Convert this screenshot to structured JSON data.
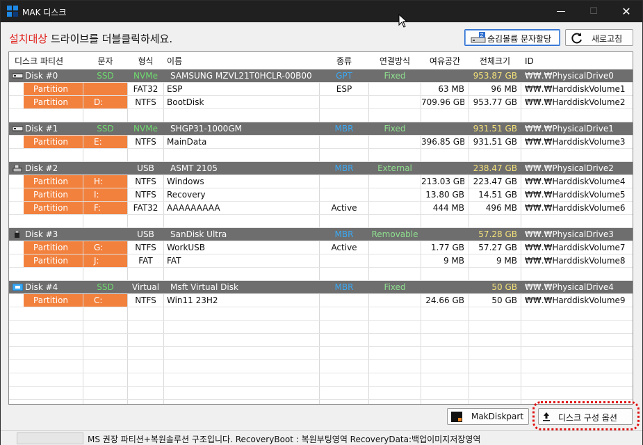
{
  "window": {
    "title": "MAK 디스크"
  },
  "instruction": {
    "highlight": "설치대상",
    "rest": " 드라이브를 더블클릭하세요."
  },
  "buttons": {
    "hide_volume": "숨김볼륨 문자할당",
    "refresh": "새로고침",
    "makdiskpart": "MakDiskpart",
    "disk_options": "디스크 구성 옵션"
  },
  "colors": {
    "disk_row_bg": "#6e6e6e",
    "partition_bg": "#f2813e",
    "ssd_green": "#6fdc6f",
    "style_blue": "#3aa9f5",
    "connect_green": "#8fe08f",
    "size_yellow": "#f5e27a",
    "accent_red": "#e0201c"
  },
  "columns": [
    "디스크 파티션",
    "문자",
    "형식",
    "이름",
    "종류",
    "연결방식",
    "여유공간",
    "전체크기",
    "ID"
  ],
  "rows": [
    {
      "kind": "disk",
      "icon": "hdd-icon",
      "label": "Disk #0",
      "letter": "SSD",
      "format": "NVMe",
      "name": "SAMSUNG MZVL21T0HCLR-00B00",
      "type": "GPT",
      "connection": "Fixed",
      "free": "",
      "total": "953.87 GB",
      "id": "₩₩.₩PhysicalDrive0"
    },
    {
      "kind": "part",
      "label": "Partition #1",
      "letter": "",
      "format": "FAT32",
      "name": "ESP",
      "type": "ESP",
      "connection": "",
      "free": "63 MB",
      "total": "96 MB",
      "id": "₩₩.₩HarddiskVolume1"
    },
    {
      "kind": "part",
      "label": "Partition #2",
      "letter": "D:",
      "format": "NTFS",
      "name": "BootDisk",
      "type": "",
      "connection": "",
      "free": "709.96 GB",
      "total": "953.77 GB",
      "id": "₩₩.₩HarddiskVolume2"
    },
    {
      "kind": "empty"
    },
    {
      "kind": "disk",
      "icon": "hdd-icon",
      "label": "Disk #1",
      "letter": "SSD",
      "format": "NVMe",
      "name": "SHGP31-1000GM",
      "type": "MBR",
      "connection": "Fixed",
      "free": "",
      "total": "931.51 GB",
      "id": "₩₩.₩PhysicalDrive1"
    },
    {
      "kind": "part",
      "label": "Partition #1",
      "letter": "E:",
      "format": "NTFS",
      "name": "MainData",
      "type": "",
      "connection": "",
      "free": "396.85 GB",
      "total": "931.51 GB",
      "id": "₩₩.₩HarddiskVolume3"
    },
    {
      "kind": "empty"
    },
    {
      "kind": "disk",
      "icon": "usb-icon",
      "label": "Disk #2",
      "letter": "",
      "format": "USB",
      "name": "ASMT 2105",
      "type": "MBR",
      "connection": "External",
      "free": "",
      "total": "238.47 GB",
      "id": "₩₩.₩PhysicalDrive2"
    },
    {
      "kind": "part",
      "label": "Partition #1",
      "letter": "H:",
      "format": "NTFS",
      "name": "Windows",
      "type": "",
      "connection": "",
      "free": "213.03 GB",
      "total": "223.47 GB",
      "id": "₩₩.₩HarddiskVolume4"
    },
    {
      "kind": "part",
      "label": "Partition #2",
      "letter": "I:",
      "format": "NTFS",
      "name": "Recovery",
      "type": "",
      "connection": "",
      "free": "13.80 GB",
      "total": "14.51 GB",
      "id": "₩₩.₩HarddiskVolume5"
    },
    {
      "kind": "part",
      "label": "Partition #3",
      "letter": "F:",
      "format": "FAT32",
      "name": "AAAAAAAAA",
      "type": "Active",
      "connection": "",
      "free": "444 MB",
      "total": "496 MB",
      "id": "₩₩.₩HarddiskVolume6"
    },
    {
      "kind": "empty"
    },
    {
      "kind": "disk",
      "icon": "usb-stick-icon",
      "label": "Disk #3",
      "letter": "",
      "format": "USB",
      "name": "SanDisk Ultra",
      "type": "MBR",
      "connection": "Removable",
      "free": "",
      "total": "57.28 GB",
      "id": "₩₩.₩PhysicalDrive3"
    },
    {
      "kind": "part",
      "label": "Partition #1",
      "letter": "G:",
      "format": "NTFS",
      "name": "WorkUSB",
      "type": "Active",
      "connection": "",
      "free": "1.77 GB",
      "total": "57.27 GB",
      "id": "₩₩.₩HarddiskVolume7"
    },
    {
      "kind": "part",
      "label": "Partition #2",
      "letter": "J:",
      "format": "FAT",
      "name": "FAT",
      "type": "",
      "connection": "",
      "free": "9 MB",
      "total": "9 MB",
      "id": "₩₩.₩HarddiskVolume8"
    },
    {
      "kind": "empty"
    },
    {
      "kind": "disk",
      "icon": "virtual-disk-icon",
      "label": "Disk #4",
      "letter": "SSD",
      "format": "Virtual",
      "name": "Msft Virtual Disk",
      "type": "MBR",
      "connection": "Fixed",
      "free": "",
      "total": "50 GB",
      "id": "₩₩.₩PhysicalDrive4"
    },
    {
      "kind": "part",
      "label": "Partition #1",
      "letter": "C:",
      "format": "NTFS",
      "name": "Win11 23H2",
      "type": "",
      "connection": "",
      "free": "24.66 GB",
      "total": "50 GB",
      "id": "₩₩.₩HarddiskVolume9"
    }
  ],
  "statusbar": {
    "text": "MS 권장 파티션+복원솔루션 구조입니다. RecoveryBoot : 복원부팅영역 RecoveryData:백업이미지저장영역"
  }
}
